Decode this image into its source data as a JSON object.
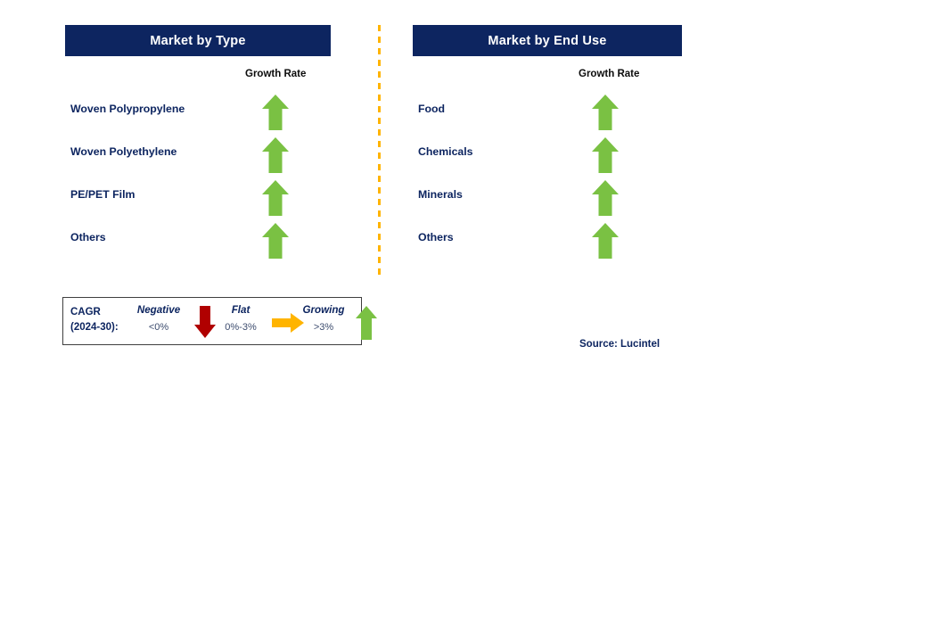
{
  "colors": {
    "header_bg": "#0d2560",
    "header_text": "#ffffff",
    "label_navy": "#0d2560",
    "arrow_green": "#7ac143",
    "arrow_red": "#b00000",
    "arrow_orange": "#ffb400",
    "divider_orange": "#ffb400",
    "legend_border": "#3f3f3f",
    "page_bg": "#ffffff"
  },
  "columns": [
    {
      "title": "Market by Type",
      "growth_rate_header": "Growth Rate",
      "rows": [
        {
          "label": "Woven Polypropylene",
          "growth": "growing",
          "icon": "arrow-up-icon"
        },
        {
          "label": "Woven Polyethylene",
          "growth": "growing",
          "icon": "arrow-up-icon"
        },
        {
          "label": "PE/PET Film",
          "growth": "growing",
          "icon": "arrow-up-icon"
        },
        {
          "label": "Others",
          "growth": "growing",
          "icon": "arrow-up-icon"
        }
      ]
    },
    {
      "title": "Market by End Use",
      "growth_rate_header": "Growth Rate",
      "rows": [
        {
          "label": "Food",
          "growth": "growing",
          "icon": "arrow-up-icon"
        },
        {
          "label": "Chemicals",
          "growth": "growing",
          "icon": "arrow-up-icon"
        },
        {
          "label": "Minerals",
          "growth": "growing",
          "icon": "arrow-up-icon"
        },
        {
          "label": "Others",
          "growth": "growing",
          "icon": "arrow-up-icon"
        }
      ]
    }
  ],
  "legend": {
    "title_line1": "CAGR",
    "title_line2": "(2024-30):",
    "items": [
      {
        "name": "Negative",
        "range": "<0%",
        "icon": "arrow-down-icon",
        "color": "#b00000"
      },
      {
        "name": "Flat",
        "range": "0%-3%",
        "icon": "arrow-right-icon",
        "color": "#ffb400"
      },
      {
        "name": "Growing",
        "range": ">3%",
        "icon": "arrow-up-icon",
        "color": "#7ac143"
      }
    ]
  },
  "source": "Source: Lucintel",
  "chart_data": {
    "type": "table",
    "title": "Market Segmentation Growth Rates",
    "categories": [
      "Market by Type",
      "Market by End Use"
    ],
    "series": [
      {
        "name": "Market by Type",
        "labels": [
          "Woven Polypropylene",
          "Woven Polyethylene",
          "PE/PET Film",
          "Others"
        ],
        "values": [
          "growing",
          "growing",
          "growing",
          "growing"
        ]
      },
      {
        "name": "Market by End Use",
        "labels": [
          "Food",
          "Chemicals",
          "Minerals",
          "Others"
        ],
        "values": [
          "growing",
          "growing",
          "growing",
          "growing"
        ]
      }
    ],
    "legend_position": "bottom-left",
    "legend_entries": [
      {
        "label": "Negative",
        "range": "<0%"
      },
      {
        "label": "Flat",
        "range": "0%-3%"
      },
      {
        "label": "Growing",
        "range": ">3%"
      }
    ]
  }
}
